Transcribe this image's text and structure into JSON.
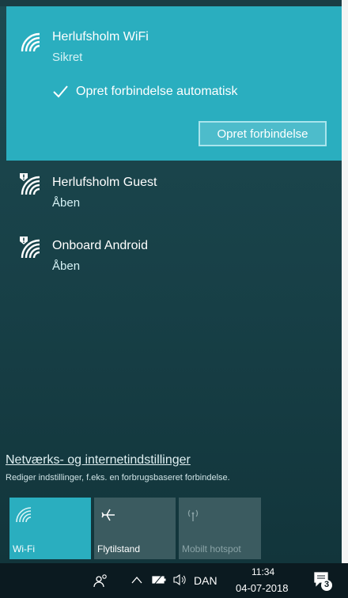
{
  "colors": {
    "accent": "#2aaebf",
    "flyout_background": "#173f46",
    "taskbar": "#0b1a20",
    "tile_active": "#2aaebf",
    "tile_inactive": "#3b5b60"
  },
  "selected_network": {
    "name": "Herlufsholm WiFi",
    "status": "Sikret",
    "icon": "wifi-signal-icon",
    "auto_connect_label": "Opret forbindelse automatisk",
    "auto_connect_checked": true,
    "connect_button_label": "Opret forbindelse"
  },
  "networks": [
    {
      "name": "Herlufsholm Guest",
      "status": "Åben",
      "icon": "wifi-open-warning-icon"
    },
    {
      "name": "Onboard Android",
      "status": "Åben",
      "icon": "wifi-open-warning-icon"
    }
  ],
  "settings": {
    "link_label": "Netværks- og internetindstillinger",
    "description": "Rediger indstillinger, f.eks. en forbrugsbaseret forbindelse."
  },
  "quick_actions": [
    {
      "label": "Wi-Fi",
      "icon": "wifi-icon",
      "active": true
    },
    {
      "label": "Flytilstand",
      "icon": "airplane-icon",
      "active": false
    },
    {
      "label": "Mobilt hotspot",
      "icon": "hotspot-icon",
      "active": false,
      "disabled": true
    }
  ],
  "taskbar": {
    "people_icon": "people-icon",
    "chevron_icon": "chevron-up-icon",
    "battery_icon": "battery-icon",
    "volume_icon": "volume-icon",
    "language": "DAN",
    "time": "11:34",
    "date": "04-07-2018",
    "notification_count": "3"
  }
}
